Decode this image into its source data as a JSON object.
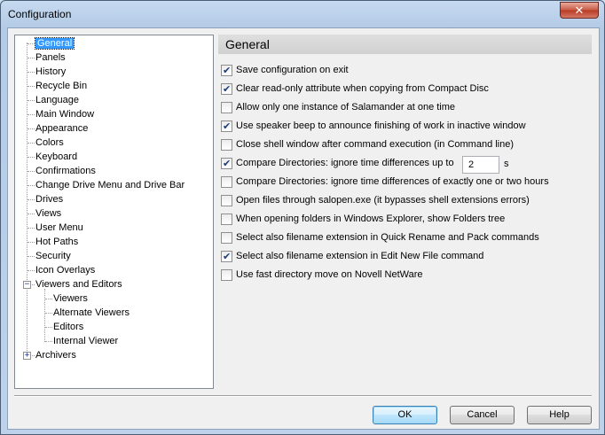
{
  "window": {
    "title": "Configuration",
    "close_glyph": "✕"
  },
  "tree": {
    "items": [
      {
        "label": "General",
        "level": 1,
        "selected": true
      },
      {
        "label": "Panels",
        "level": 1
      },
      {
        "label": "History",
        "level": 1
      },
      {
        "label": "Recycle Bin",
        "level": 1
      },
      {
        "label": "Language",
        "level": 1
      },
      {
        "label": "Main Window",
        "level": 1
      },
      {
        "label": "Appearance",
        "level": 1
      },
      {
        "label": "Colors",
        "level": 1
      },
      {
        "label": "Keyboard",
        "level": 1
      },
      {
        "label": "Confirmations",
        "level": 1
      },
      {
        "label": "Change Drive Menu and Drive Bar",
        "level": 1
      },
      {
        "label": "Drives",
        "level": 1
      },
      {
        "label": "Views",
        "level": 1
      },
      {
        "label": "User Menu",
        "level": 1
      },
      {
        "label": "Hot Paths",
        "level": 1
      },
      {
        "label": "Security",
        "level": 1
      },
      {
        "label": "Icon Overlays",
        "level": 1
      },
      {
        "label": "Viewers and Editors",
        "level": 1,
        "expander": "−"
      },
      {
        "label": "Viewers",
        "level": 2
      },
      {
        "label": "Alternate Viewers",
        "level": 2
      },
      {
        "label": "Editors",
        "level": 2
      },
      {
        "label": "Internal Viewer",
        "level": 2
      },
      {
        "label": "Archivers",
        "level": 1,
        "expander": "+"
      }
    ]
  },
  "panel": {
    "header": "General",
    "options": [
      {
        "label": "Save configuration on exit",
        "checked": true
      },
      {
        "label": "Clear read-only attribute when copying from Compact Disc",
        "checked": true
      },
      {
        "label": "Allow only one instance of Salamander at one time",
        "checked": false
      },
      {
        "label": "Use speaker beep to announce finishing of work in inactive window",
        "checked": true
      },
      {
        "label": "Close shell window after command execution (in Command line)",
        "checked": false
      },
      {
        "label": "Compare Directories: ignore time differences up to",
        "checked": true
      },
      {
        "label": "Compare Directories: ignore time differences of exactly one or two hours",
        "checked": false
      },
      {
        "label": "Open files through salopen.exe (it bypasses shell extensions errors)",
        "checked": false
      },
      {
        "label": "When opening folders in Windows Explorer, show Folders tree",
        "checked": false
      },
      {
        "label": "Select also filename extension in Quick Rename and Pack commands",
        "checked": false
      },
      {
        "label": "Select also filename extension in Edit New File command",
        "checked": true
      },
      {
        "label": "Use fast directory move on Novell NetWare",
        "checked": false
      }
    ],
    "time_diff_value": "2",
    "time_diff_unit": "s"
  },
  "buttons": {
    "ok": "OK",
    "cancel": "Cancel",
    "help": "Help"
  }
}
